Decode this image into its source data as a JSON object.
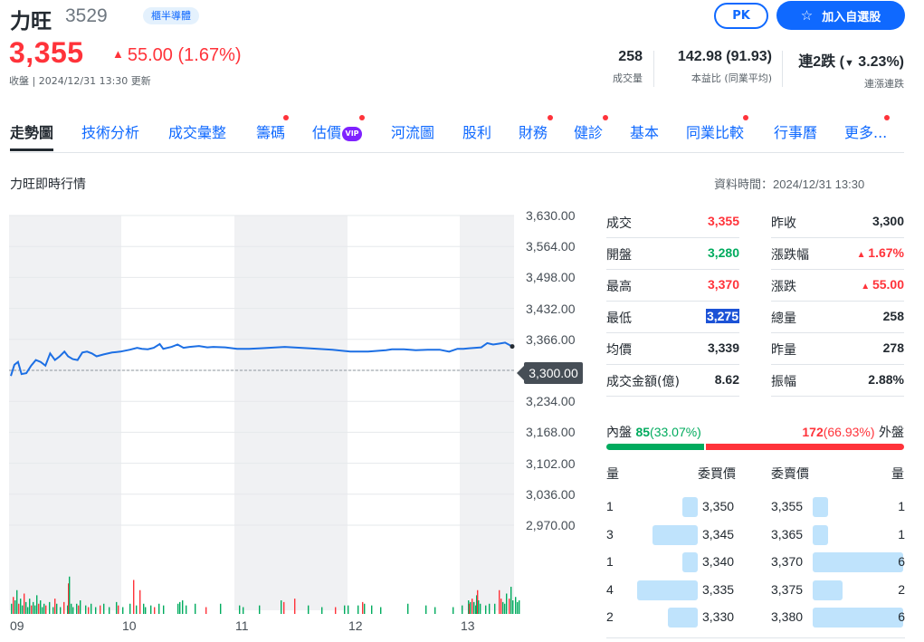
{
  "header": {
    "name": "力旺",
    "code": "3529",
    "market_badge": "櫃半導體",
    "pk_label": "PK",
    "watchlist_label": "加入自選股",
    "price": "3,355",
    "change": "55.00 (1.67%)",
    "close_info": "收盤 | 2024/12/31 13:30 更新",
    "up_color": "#ff333a",
    "down_color": "#00ab5e",
    "accent": "#0f69ff"
  },
  "stats": [
    {
      "value": "258",
      "label": "成交量"
    },
    {
      "value": "142.98 (91.93)",
      "label": "本益比 (同業平均)"
    },
    {
      "value_prefix": "連2跌 (",
      "value_change": "3.23%",
      "value_suffix": ")",
      "label": "連漲連跌"
    }
  ],
  "tabs": [
    "走勢圖",
    "技術分析",
    "成交彙整",
    "籌碼",
    "估價",
    "河流圖",
    "股利",
    "財務",
    "健診",
    "基本",
    "同業比較",
    "行事曆",
    "更多..."
  ],
  "vip_label": "VIP",
  "section_title": "力旺即時行情",
  "data_time": "資料時間：2024/12/31 13:30",
  "chart_data": {
    "type": "line",
    "x_ticks": [
      "09",
      "10",
      "11",
      "12",
      "13"
    ],
    "y_ticks": [
      "3,630.00",
      "3,564.00",
      "3,498.00",
      "3,432.00",
      "3,366.00",
      "3,300.00",
      "3,234.00",
      "3,168.00",
      "3,102.00",
      "3,036.00",
      "2,970.00"
    ],
    "ylim": [
      2970,
      3630
    ],
    "reference_price": 3300,
    "reference_label": "3,300.00",
    "line_color": "#1c6fe4",
    "price_series": [
      [
        0,
        3288
      ],
      [
        3,
        3312
      ],
      [
        6,
        3318
      ],
      [
        9,
        3292
      ],
      [
        13,
        3294
      ],
      [
        17,
        3310
      ],
      [
        21,
        3322
      ],
      [
        25,
        3318
      ],
      [
        29,
        3310
      ],
      [
        33,
        3336
      ],
      [
        37,
        3322
      ],
      [
        41,
        3330
      ],
      [
        45,
        3340
      ],
      [
        48,
        3330
      ],
      [
        52,
        3324
      ],
      [
        56,
        3322
      ],
      [
        60,
        3338
      ],
      [
        64,
        3340
      ],
      [
        68,
        3336
      ],
      [
        72,
        3330
      ],
      [
        78,
        3334
      ],
      [
        85,
        3338
      ],
      [
        92,
        3340
      ],
      [
        100,
        3344
      ],
      [
        106,
        3348
      ],
      [
        110,
        3346
      ],
      [
        115,
        3345
      ],
      [
        120,
        3348
      ],
      [
        125,
        3356
      ],
      [
        128,
        3346
      ],
      [
        135,
        3350
      ],
      [
        140,
        3355
      ],
      [
        145,
        3348
      ],
      [
        150,
        3350
      ],
      [
        158,
        3352
      ],
      [
        165,
        3349
      ],
      [
        170,
        3350
      ],
      [
        180,
        3349
      ],
      [
        190,
        3346
      ],
      [
        200,
        3346
      ],
      [
        210,
        3347
      ],
      [
        230,
        3350
      ],
      [
        250,
        3347
      ],
      [
        270,
        3344
      ],
      [
        285,
        3340
      ],
      [
        300,
        3340
      ],
      [
        315,
        3343
      ],
      [
        320,
        3345
      ],
      [
        330,
        3345
      ],
      [
        340,
        3343
      ],
      [
        350,
        3344
      ],
      [
        360,
        3344
      ],
      [
        368,
        3340
      ],
      [
        375,
        3346
      ],
      [
        380,
        3346
      ],
      [
        385,
        3347
      ],
      [
        390,
        3348
      ],
      [
        395,
        3349
      ],
      [
        400,
        3358
      ],
      [
        405,
        3355
      ],
      [
        410,
        3357
      ],
      [
        415,
        3359
      ],
      [
        421,
        3351
      ]
    ],
    "volume_max": 40,
    "volume_bars": [
      [
        2,
        6,
        "g"
      ],
      [
        4,
        10,
        "r"
      ],
      [
        6,
        8,
        "g"
      ],
      [
        8,
        14,
        "g"
      ],
      [
        10,
        6,
        "r"
      ],
      [
        12,
        9,
        "g"
      ],
      [
        14,
        5,
        "g"
      ],
      [
        16,
        12,
        "r"
      ],
      [
        18,
        7,
        "g"
      ],
      [
        20,
        4,
        "g"
      ],
      [
        22,
        9,
        "g"
      ],
      [
        24,
        5,
        "r"
      ],
      [
        26,
        7,
        "g"
      ],
      [
        28,
        5,
        "g"
      ],
      [
        30,
        11,
        "g"
      ],
      [
        32,
        6,
        "r"
      ],
      [
        34,
        8,
        "g"
      ],
      [
        36,
        4,
        "g"
      ],
      [
        38,
        6,
        "g"
      ],
      [
        40,
        5,
        "r"
      ],
      [
        44,
        7,
        "g"
      ],
      [
        48,
        4,
        "g"
      ],
      [
        50,
        9,
        "r"
      ],
      [
        52,
        6,
        "g"
      ],
      [
        56,
        4,
        "g"
      ],
      [
        60,
        7,
        "r"
      ],
      [
        64,
        5,
        "g"
      ],
      [
        65,
        18,
        "r"
      ],
      [
        66,
        22,
        "g"
      ],
      [
        68,
        6,
        "g"
      ],
      [
        70,
        4,
        "g"
      ],
      [
        74,
        6,
        "g"
      ],
      [
        76,
        5,
        "r"
      ],
      [
        78,
        8,
        "g"
      ],
      [
        84,
        5,
        "g"
      ],
      [
        87,
        4,
        "r"
      ],
      [
        90,
        6,
        "g"
      ],
      [
        95,
        4,
        "g"
      ],
      [
        100,
        5,
        "r"
      ],
      [
        104,
        6,
        "g"
      ],
      [
        110,
        4,
        "g"
      ],
      [
        118,
        7,
        "g"
      ],
      [
        120,
        5,
        "r"
      ],
      [
        125,
        4,
        "g"
      ],
      [
        133,
        6,
        "g"
      ],
      [
        137,
        20,
        "r"
      ],
      [
        140,
        5,
        "g"
      ],
      [
        144,
        14,
        "r"
      ],
      [
        148,
        6,
        "g"
      ],
      [
        150,
        4,
        "g"
      ],
      [
        156,
        5,
        "g"
      ],
      [
        160,
        4,
        "r"
      ],
      [
        165,
        6,
        "g"
      ],
      [
        170,
        5,
        "g"
      ],
      [
        186,
        6,
        "g"
      ],
      [
        188,
        7,
        "g"
      ],
      [
        191,
        8,
        "g"
      ],
      [
        195,
        5,
        "g"
      ],
      [
        205,
        6,
        "g"
      ],
      [
        217,
        4,
        "r"
      ],
      [
        233,
        6,
        "g"
      ],
      [
        254,
        5,
        "g"
      ],
      [
        258,
        4,
        "g"
      ],
      [
        276,
        5,
        "g"
      ],
      [
        300,
        8,
        "g"
      ],
      [
        303,
        7,
        "r"
      ],
      [
        315,
        9,
        "r"
      ],
      [
        330,
        5,
        "g"
      ],
      [
        345,
        4,
        "g"
      ],
      [
        360,
        4,
        "r"
      ],
      [
        370,
        5,
        "g"
      ],
      [
        374,
        5,
        "g"
      ],
      [
        385,
        5,
        "g"
      ],
      [
        390,
        7,
        "r"
      ],
      [
        392,
        6,
        "g"
      ],
      [
        400,
        5,
        "g"
      ],
      [
        410,
        4,
        "g"
      ],
      [
        440,
        6,
        "g"
      ],
      [
        460,
        5,
        "g"
      ],
      [
        470,
        4,
        "g"
      ],
      [
        490,
        4,
        "g"
      ],
      [
        500,
        5,
        "g"
      ],
      [
        507,
        8,
        "g"
      ],
      [
        508,
        6,
        "r"
      ],
      [
        509,
        7,
        "g"
      ],
      [
        511,
        9,
        "r"
      ],
      [
        513,
        7,
        "g"
      ],
      [
        515,
        5,
        "g"
      ],
      [
        516,
        11,
        "g"
      ],
      [
        517,
        14,
        "r"
      ],
      [
        518,
        8,
        "g"
      ],
      [
        520,
        6,
        "g"
      ],
      [
        526,
        5,
        "g"
      ],
      [
        530,
        6,
        "g"
      ],
      [
        536,
        6,
        "g"
      ],
      [
        541,
        14,
        "r"
      ],
      [
        543,
        9,
        "r"
      ],
      [
        545,
        7,
        "g"
      ],
      [
        547,
        6,
        "g"
      ],
      [
        549,
        12,
        "g"
      ],
      [
        552,
        9,
        "r"
      ],
      [
        554,
        16,
        "g"
      ],
      [
        556,
        8,
        "g"
      ],
      [
        559,
        10,
        "g"
      ],
      [
        561,
        7,
        "g"
      ],
      [
        563,
        8,
        "g"
      ],
      [
        565,
        12,
        "g"
      ],
      [
        567,
        36,
        "g"
      ]
    ]
  },
  "quote": {
    "left": [
      {
        "label": "成交",
        "value": "3,355",
        "color": "red"
      },
      {
        "label": "開盤",
        "value": "3,280",
        "color": "green"
      },
      {
        "label": "最高",
        "value": "3,370",
        "color": "red"
      },
      {
        "label": "最低",
        "value": "3,275",
        "color": "highlight"
      },
      {
        "label": "均價",
        "value": "3,339",
        "color": "black"
      },
      {
        "label": "成交金額(億)",
        "value": "8.62",
        "color": "black"
      }
    ],
    "right": [
      {
        "label": "昨收",
        "value": "3,300",
        "color": "black"
      },
      {
        "label": "漲跌幅",
        "value": "1.67%",
        "color": "red",
        "arrow": true
      },
      {
        "label": "漲跌",
        "value": "55.00",
        "color": "red",
        "arrow": true
      },
      {
        "label": "總量",
        "value": "258",
        "color": "black"
      },
      {
        "label": "昨量",
        "value": "278",
        "color": "black"
      },
      {
        "label": "振幅",
        "value": "2.88%",
        "color": "black"
      }
    ]
  },
  "inner_outer": {
    "inner_label": "內盤",
    "inner_value": "85",
    "inner_pct": "(33.07%)",
    "outer_value": "172",
    "outer_pct": "(66.93%)",
    "outer_label": "外盤",
    "inner_share": 0.3307
  },
  "order_book": {
    "headers": {
      "bid_qty": "量",
      "bid_price": "委買價",
      "ask_price": "委賣價",
      "ask_qty": "量"
    },
    "rows": [
      {
        "bid_qty": "1",
        "bid_price": "3,350",
        "ask_price": "3,355",
        "ask_qty": "1",
        "bid_share": 0.17,
        "ask_share": 0.17
      },
      {
        "bid_qty": "3",
        "bid_price": "3,345",
        "ask_price": "3,365",
        "ask_qty": "1",
        "bid_share": 0.5,
        "ask_share": 0.17
      },
      {
        "bid_qty": "1",
        "bid_price": "3,340",
        "ask_price": "3,370",
        "ask_qty": "6",
        "bid_share": 0.17,
        "ask_share": 1.0
      },
      {
        "bid_qty": "4",
        "bid_price": "3,335",
        "ask_price": "3,375",
        "ask_qty": "2",
        "bid_share": 0.67,
        "ask_share": 0.33
      },
      {
        "bid_qty": "2",
        "bid_price": "3,330",
        "ask_price": "3,380",
        "ask_qty": "6",
        "bid_share": 0.33,
        "ask_share": 1.0
      }
    ]
  }
}
